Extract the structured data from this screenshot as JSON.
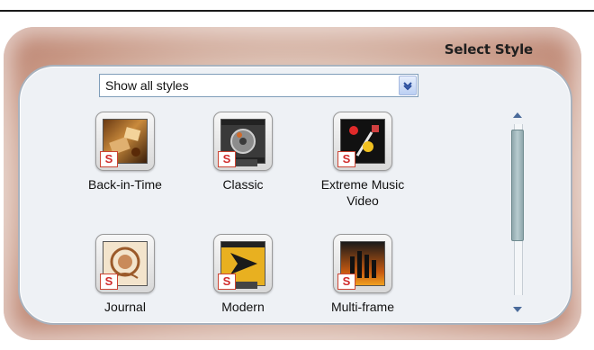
{
  "panel": {
    "title": "Select Style"
  },
  "filter": {
    "selected": "Show all styles"
  },
  "styles": [
    {
      "label": "Back-in-Time",
      "icon": "back-in-time-thumbnail"
    },
    {
      "label": "Classic",
      "icon": "classic-film-thumbnail"
    },
    {
      "label": "Extreme Music Video",
      "icon": "extreme-music-video-thumbnail"
    },
    {
      "label": "Journal",
      "icon": "journal-thumbnail"
    },
    {
      "label": "Modern",
      "icon": "modern-thumbnail"
    },
    {
      "label": "Multi-frame",
      "icon": "multi-frame-thumbnail"
    }
  ],
  "badge_text": "S",
  "colors": {
    "panel_bg": "#eef1f5",
    "frame_edge": "#b97f6c",
    "badge_red": "#d02a2a",
    "scroll_thumb": "#a4bcc1"
  }
}
